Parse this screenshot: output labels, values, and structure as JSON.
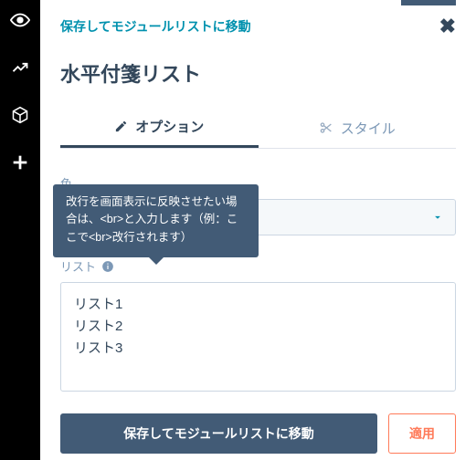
{
  "sidebar": {
    "items": [
      {
        "name": "eye-icon"
      },
      {
        "name": "chart-icon"
      },
      {
        "name": "cube-icon"
      },
      {
        "name": "plus-icon"
      }
    ]
  },
  "top": {
    "save_and_go_label": "保存してモジュールリストに移動",
    "close_symbol": "✖"
  },
  "title": "水平付箋リスト",
  "tabs": {
    "options": {
      "label": "オプション"
    },
    "style": {
      "label": "スタイル"
    }
  },
  "form": {
    "color": {
      "label": "色"
    },
    "list": {
      "label": "リスト",
      "value": "リスト1\nリスト2\nリスト3"
    }
  },
  "tooltip": "改行を画面表示に反映させたい場合は、<br>と入力します（例：ここで<br>改行されます）",
  "buttons": {
    "save_and_go": "保存してモジュールリストに移動",
    "apply": "適用"
  }
}
